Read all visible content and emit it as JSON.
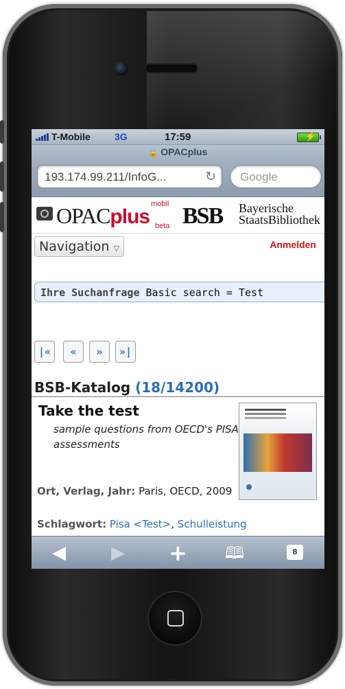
{
  "status": {
    "carrier": "T-Mobile",
    "network": "3G",
    "time": "17:59"
  },
  "browser": {
    "page_title": "OPACplus",
    "url": "193.174.99.211/InfoG...",
    "search_placeholder": "Google"
  },
  "header": {
    "opac_name": "OPAC",
    "opac_plus": "plus",
    "opac_mobil": "mobil",
    "opac_beta": "beta",
    "bsb_abbr": "BSB",
    "bsb_line1": "Bayerische",
    "bsb_line2": "StaatsBibliothek"
  },
  "nav": {
    "navigation_label": "Navigation",
    "login_label": "Anmelden"
  },
  "query": {
    "label": "Ihre Suchanfrage",
    "value": "Basic search = Test"
  },
  "pager": {
    "first": "|«",
    "prev": "«",
    "next": "»",
    "last": "»|"
  },
  "catalog": {
    "name": "BSB-Katalog",
    "count": "(18/14200)"
  },
  "record": {
    "title": "Take the test",
    "subtitle": "sample questions from OECD's PISA assessments",
    "place_label": "Ort, Verlag, Jahr:",
    "place_value": "Paris, OECD, 2009",
    "subject_label": "Schlagwort:",
    "subject_1": "Pisa <Test>",
    "subject_sep": ",",
    "subject_2": "Schulleistung"
  },
  "toolbar": {
    "back_icon": "back-arrow-icon",
    "forward_icon": "forward-arrow-icon",
    "add_icon": "plus-icon",
    "bookmarks_icon": "bookmarks-icon",
    "pages_count": "8"
  },
  "colors": {
    "brand_red": "#c8102e",
    "link_blue": "#2a6fb8"
  }
}
